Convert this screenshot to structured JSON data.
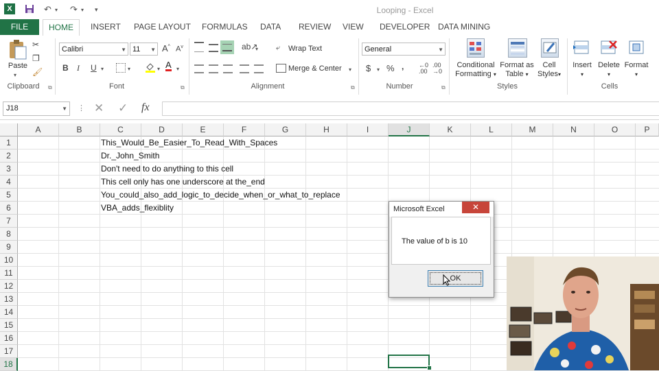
{
  "window": {
    "title": "Looping - Excel"
  },
  "quick_access": {
    "undo": "↶",
    "redo": "↷"
  },
  "tabs": [
    "FILE",
    "HOME",
    "INSERT",
    "PAGE LAYOUT",
    "FORMULAS",
    "DATA",
    "REVIEW",
    "VIEW",
    "DEVELOPER",
    "DATA MINING"
  ],
  "ribbon": {
    "clipboard": {
      "paste_label": "Paste",
      "group_label": "Clipboard"
    },
    "font": {
      "font_name": "Calibri",
      "font_size": "11",
      "group_label": "Font"
    },
    "alignment": {
      "wrap_text": "Wrap Text",
      "merge_center": "Merge & Center",
      "group_label": "Alignment"
    },
    "number": {
      "format": "General",
      "currency": "$",
      "percent": "%",
      "group_label": "Number"
    },
    "styles": {
      "conditional_1": "Conditional",
      "conditional_2": "Formatting",
      "format_table_1": "Format as",
      "format_table_2": "Table",
      "cell_styles_1": "Cell",
      "cell_styles_2": "Styles",
      "group_label": "Styles"
    },
    "cells": {
      "insert": "Insert",
      "delete": "Delete",
      "format": "Format",
      "group_label": "Cells"
    }
  },
  "formula_bar": {
    "name_box": "J18",
    "fx": "fx",
    "cancel": "✕",
    "enter": "✓",
    "value": ""
  },
  "columns": [
    "A",
    "B",
    "C",
    "D",
    "E",
    "F",
    "G",
    "H",
    "I",
    "J",
    "K",
    "L",
    "M",
    "N",
    "O",
    "P"
  ],
  "rows": [
    "1",
    "2",
    "3",
    "4",
    "5",
    "6",
    "7",
    "8",
    "9",
    "10",
    "11",
    "12",
    "13",
    "14",
    "15",
    "16",
    "17",
    "18"
  ],
  "cells": [
    "This_Would_Be_Easier_To_Read_With_Spaces",
    "Dr._John_Smith",
    "Don't need to do anything to this cell",
    "This cell only has one underscore at the_end",
    "You_could_also_add_logic_to_decide_when_or_what_to_replace",
    "VBA_adds_flexiblity"
  ],
  "dialog": {
    "title": "Microsoft Excel",
    "message": "The value of b is 10",
    "ok": "OK",
    "close": "✕"
  },
  "colors": {
    "excel_green": "#217346",
    "close_red": "#c7453a"
  }
}
